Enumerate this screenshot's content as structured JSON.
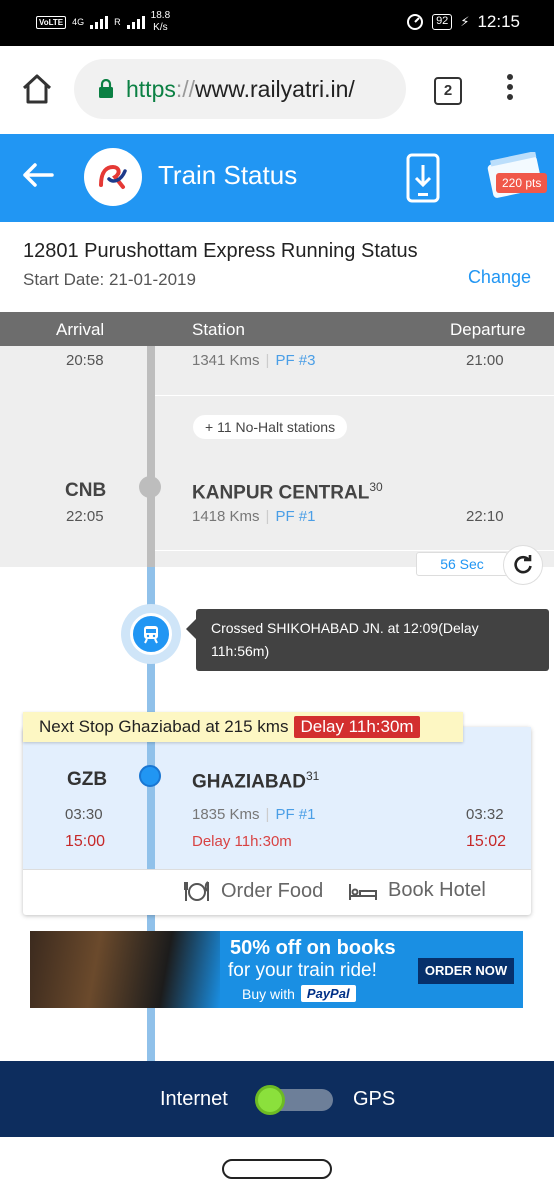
{
  "status_bar": {
    "volte": "VoLTE",
    "network": "4G",
    "roaming": "R",
    "speed_value": "18.8",
    "speed_unit": "K/s",
    "battery": "92",
    "time": "12:15"
  },
  "browser": {
    "url_scheme": "https",
    "url_sep": "://",
    "url_host": "www.railyatri.in/",
    "tab_count": "2"
  },
  "app_header": {
    "title": "Train Status",
    "points": "220 pts"
  },
  "train": {
    "name": "12801 Purushottam Express Running Status",
    "start_date": "Start Date: 21-01-2019",
    "change_label": "Change"
  },
  "columns": {
    "arrival": "Arrival",
    "station": "Station",
    "departure": "Departure"
  },
  "passed_station": {
    "arrival": "20:58",
    "kms": "1341 Kms",
    "pf": "PF #3",
    "departure": "21:00"
  },
  "no_halt": {
    "prefix": "+",
    "text": "11 No-Halt stations"
  },
  "kanpur": {
    "code": "CNB",
    "name": "KANPUR CENTRAL",
    "sup": "30",
    "arrival": "22:05",
    "kms": "1418 Kms",
    "pf": "PF #1",
    "departure": "22:10"
  },
  "refresh": {
    "countdown": "56 Sec"
  },
  "current_position": {
    "message_line1": "Crossed SHIKOHABAD JN. at 12:09(Delay",
    "message_line2": "11h:56m)"
  },
  "next_stop": {
    "banner_text": "Next Stop Ghaziabad at 215 kms",
    "banner_delay": "Delay 11h:30m",
    "code": "GZB",
    "name": "GHAZIABAD",
    "sup": "31",
    "sched_arrival": "03:30",
    "exp_arrival": "15:00",
    "kms": "1835 Kms",
    "pf": "PF #1",
    "delay": "Delay 11h:30m",
    "sched_departure": "03:32",
    "exp_departure": "15:02",
    "order_food": "Order Food",
    "book_hotel": "Book Hotel"
  },
  "ad": {
    "line1": "50% off on books",
    "line2": "for your train ride!",
    "line3": "Buy with",
    "paypal": "PayPal",
    "cta": "ORDER NOW"
  },
  "toggle": {
    "left_label": "Internet",
    "right_label": "GPS",
    "selected": "Internet"
  },
  "colors": {
    "primary": "#2196f3",
    "toggle_bar": "#0d2d5e",
    "delay_red": "#d32f2f",
    "banner_yellow": "#fdf7c3"
  }
}
